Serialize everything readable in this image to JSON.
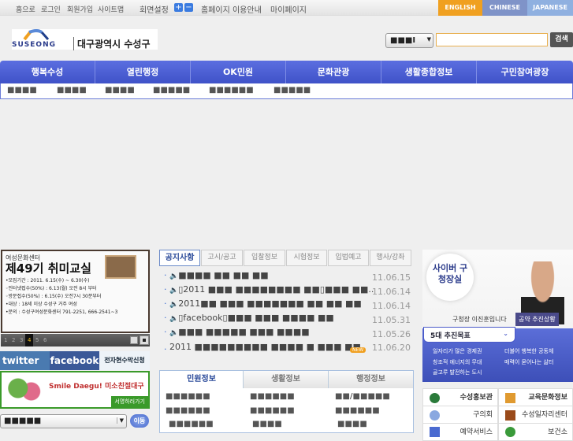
{
  "topbar": {
    "links": [
      "홈으로",
      "로그인",
      "회원가입",
      "사이트맵"
    ],
    "screen_setting": "회면설정",
    "plus": "+",
    "minus": "−",
    "guide": "홈페이지 이용안내",
    "mypage": "마이페이지",
    "languages": [
      "ENGLISH",
      "CHINESE",
      "JAPANESE"
    ]
  },
  "header": {
    "logo_en": "SUSEONG",
    "logo_kr": "대구광역시 수성구",
    "search_select": "■■■I",
    "search_value": "",
    "search_button": "검색"
  },
  "nav": {
    "items": [
      "행복수성",
      "열린행정",
      "OK민원",
      "문화관광",
      "생활종합정보",
      "구민참여광장"
    ],
    "sub": [
      "■■■■",
      "■■■■",
      "■■■■",
      "■■■■■",
      "■■■■■■",
      "■■■■■"
    ]
  },
  "banner": {
    "org": "여성문화센터",
    "title": "제49기 취미교실",
    "lines": [
      "•모집기간 : 2011. 6.15(수) ~ 6.30(수)",
      "◦인터넷접수(50%) : 6.13(월) 오전 8시 부터",
      "◦방문접수(50%) : 6.15(수) 오전7시 30분부터",
      "•대상 : 18세 이상 수성구 거주 여성",
      "•문의 : 수성구여성문화센터 791-2251, 666-2541~3"
    ],
    "pages": [
      "1",
      "2",
      "3",
      "4",
      "5",
      "6"
    ],
    "active_page": 4
  },
  "social": {
    "twitter": "twitter",
    "facebook": "facebook",
    "petition": "전자현수막신청",
    "smile": "Smile Daegu! 미소친절대구",
    "smile_link": "서명하러가기"
  },
  "quick_select": {
    "value": "■■■■■",
    "go": "이동"
  },
  "notice": {
    "tabs": [
      "공지사항",
      "고시/공고",
      "입찰정보",
      "시험정보",
      "입법예고",
      "행사/강좌"
    ],
    "items": [
      {
        "title": "■■■■ ■■ ■■ ■■",
        "date": "11.06.15"
      },
      {
        "title": "▯2011 ■■■ ■■■■■■■■ ■■▯■■■ ■■..",
        "date": "11.06.14"
      },
      {
        "title": "2011■■ ■■■ ■■■■■■■ ■■ ■■ ■■",
        "date": "11.06.14"
      },
      {
        "title": "▯facebook▯■■■ ■■■ ■■■■ ■■",
        "date": "11.05.31"
      },
      {
        "title": "■■■ ■■■■■ ■■■ ■■■■",
        "date": "11.05.26"
      },
      {
        "title": "2011 ■■■■■■■■■ ■■■■ ■ ■■■ ■■",
        "date": "11.06.20",
        "badge": "NEW"
      }
    ]
  },
  "info": {
    "tabs": [
      "민원정보",
      "생활정보",
      "행정정보"
    ],
    "cols": [
      [
        "■■■■■■",
        "■■■■■■",
        "■■■■■■"
      ],
      [
        "■■■■■■",
        "■■■■■■",
        "■■■■"
      ],
      [
        "■■/■■■■■",
        "■■■■■■",
        "■■■■"
      ]
    ]
  },
  "mayor": {
    "title": "사이버 구청장실",
    "greeting": "구청장 이진훈입니다",
    "pledge": "공약 추진상황",
    "goals_title": "5대 추진목표",
    "goals": [
      "일자리가 많은 경제권",
      "더불어 행복한 공동체",
      "창조적 에너지의 무대",
      "매력이 묻어나는 삶터",
      "골고루 발전하는 도시"
    ]
  },
  "links": [
    "수성홍보관",
    "교육문화정보",
    "구의회",
    "수성일자리센터",
    "예약서비스",
    "보건소"
  ]
}
